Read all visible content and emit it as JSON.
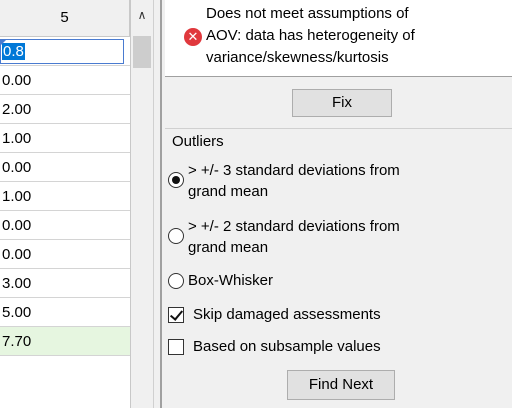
{
  "grid": {
    "header": "5",
    "editing_value": "0.8",
    "rows": [
      "0.00",
      "2.00",
      "1.00",
      "0.00",
      "1.00",
      "0.00",
      "0.00",
      "3.00",
      "5.00",
      "7.70"
    ]
  },
  "message": {
    "icon": "error-icon",
    "text": "Does not meet assumptions of AOV: data has heterogeneity of variance/skewness/kurtosis",
    "lines": [
      "Does not meet assumptions of",
      "AOV: data has heterogeneity of",
      "variance/skewness/kurtosis"
    ]
  },
  "fix_button": "Fix",
  "outliers": {
    "title": "Outliers",
    "options": [
      {
        "line1": "> +/- 3 standard deviations from",
        "line2": "grand mean",
        "checked": true
      },
      {
        "line1": "> +/- 2 standard deviations from",
        "line2": "grand mean",
        "checked": false
      },
      {
        "line1": "Box-Whisker",
        "line2": "",
        "checked": false
      }
    ]
  },
  "checks": [
    {
      "label": "Skip damaged assessments",
      "checked": true
    },
    {
      "label": "Based on subsample values",
      "checked": false
    }
  ],
  "find_next_button": "Find Next",
  "colors": {
    "error": "#e0383d",
    "selection": "#0078d7",
    "green_row": "#e6f6e0"
  }
}
